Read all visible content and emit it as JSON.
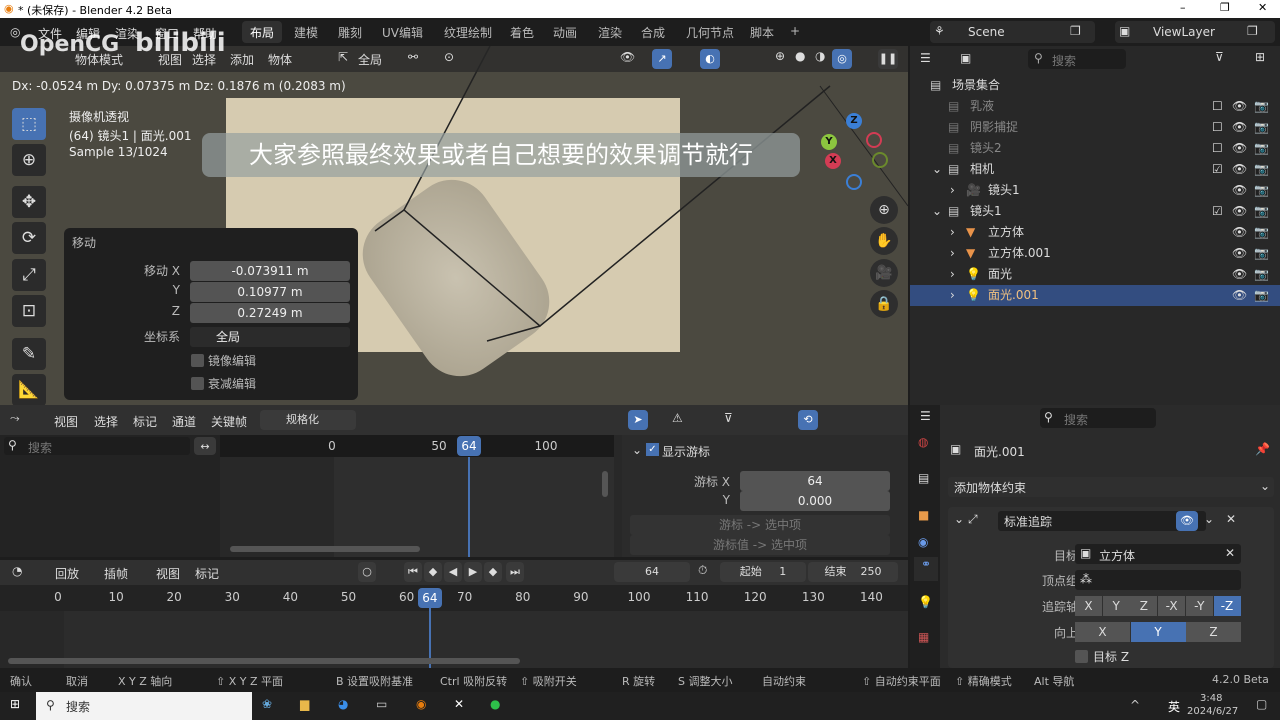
{
  "window": {
    "title": "* (未保存) - Blender 4.2 Beta",
    "min": "–",
    "max": "❐",
    "close": "✕"
  },
  "menu": [
    "文件",
    "编辑",
    "渲染",
    "窗口",
    "帮助"
  ],
  "workspaces": [
    "布局",
    "建模",
    "雕刻",
    "UV编辑",
    "纹理绘制",
    "着色",
    "动画",
    "渲染",
    "合成",
    "几何节点",
    "脚本",
    "+"
  ],
  "watermark": {
    "brand": "OpenCG",
    "site": "bilibili"
  },
  "scene": {
    "name": "Scene",
    "view_layer": "ViewLayer"
  },
  "viewport": {
    "mode": "物体模式",
    "menus": [
      "视图",
      "选择",
      "添加",
      "物体"
    ],
    "orientation": "全局",
    "delta": "Dx: -0.0524 m  Dy: 0.07375 m  Dz: 0.1876 m (0.2083 m)",
    "info": [
      "摄像机透视",
      "(64) 镜头1 | 面光.001",
      "Sample 13/1024"
    ],
    "subtitle": "大家参照最终效果或者自己想要的效果调节就行",
    "gizmo": {
      "x": "X",
      "y": "Y",
      "z": "Z"
    }
  },
  "move_panel": {
    "title": "移动",
    "fields": [
      {
        "label": "移动 X",
        "value": "-0.073911 m"
      },
      {
        "label": "Y",
        "value": "0.10977 m"
      },
      {
        "label": "Z",
        "value": "0.27249 m"
      }
    ],
    "coord_label": "坐标系",
    "coord_value": "全局",
    "mirror": "镜像编辑",
    "falloff": "衰减编辑"
  },
  "outliner": {
    "search_placeholder": "搜索",
    "rows": [
      {
        "name": "场景集合",
        "indent": 0
      },
      {
        "name": "乳液",
        "indent": 1,
        "dim": true
      },
      {
        "name": "阴影捕捉",
        "indent": 1,
        "dim": true
      },
      {
        "name": "镜头2",
        "indent": 1,
        "dim": true
      },
      {
        "name": "相机",
        "indent": 1
      },
      {
        "name": "镜头1",
        "indent": 2
      },
      {
        "name": "镜头1",
        "indent": 1
      },
      {
        "name": "立方体",
        "indent": 2
      },
      {
        "name": "立方体.001",
        "indent": 2
      },
      {
        "name": "面光",
        "indent": 2
      },
      {
        "name": "面光.001",
        "indent": 2,
        "selected": true
      }
    ]
  },
  "graph": {
    "menus": [
      "视图",
      "选择",
      "标记",
      "通道",
      "关键帧"
    ],
    "normalize": "规格化",
    "search_placeholder": "搜索",
    "ticks": [
      "0",
      "50",
      "100"
    ],
    "current": "64",
    "sidebar": {
      "show_cursor": "显示游标",
      "cursor_x_label": "游标 X",
      "cursor_x": "64",
      "y_label": "Y",
      "y": "0.000",
      "btn1": "游标 -> 选中项",
      "btn2": "游标值 -> 选中项"
    }
  },
  "timeline": {
    "menus": [
      "回放",
      "插帧",
      "视图",
      "标记"
    ],
    "frame": "64",
    "start_label": "起始",
    "start": "1",
    "end_label": "结束",
    "end": "250",
    "ticks": [
      "0",
      "10",
      "20",
      "30",
      "40",
      "50",
      "60",
      "70",
      "80",
      "90",
      "100",
      "110",
      "120",
      "130",
      "140"
    ],
    "current": "64"
  },
  "properties": {
    "search_placeholder": "搜索",
    "object": "面光.001",
    "add_constraint": "添加物体约束",
    "constraint_name": "标准追踪",
    "target_label": "目标",
    "target": "立方体",
    "vgroup_label": "顶点组",
    "track_label": "追踪轴",
    "track_axes": [
      "X",
      "Y",
      "Z",
      "-X",
      "-Y",
      "-Z"
    ],
    "track_active": "-Z",
    "up_label": "向上",
    "up_axes": [
      "X",
      "Y",
      "Z"
    ],
    "up_active": "Y",
    "target_z": "目标 Z"
  },
  "statusbar": {
    "items": [
      "确认",
      "取消",
      "X Y Z 轴向",
      "⇧ X Y Z 平面",
      "B 设置吸附基准",
      "Ctrl 吸附反转",
      "⇧ 吸附开关",
      "R 旋转",
      "S 调整大小",
      "自动约束",
      "⇧ 自动约束平面",
      "⇧ 精确模式",
      "Alt 导航"
    ],
    "version": "4.2.0 Beta"
  },
  "taskbar": {
    "search": "搜索",
    "ime": "英",
    "time": "3:48",
    "date": "2024/6/27"
  },
  "colors": {
    "accent": "#4772b3",
    "viewport": "#4b4940",
    "frame": "#d6cbb0"
  }
}
